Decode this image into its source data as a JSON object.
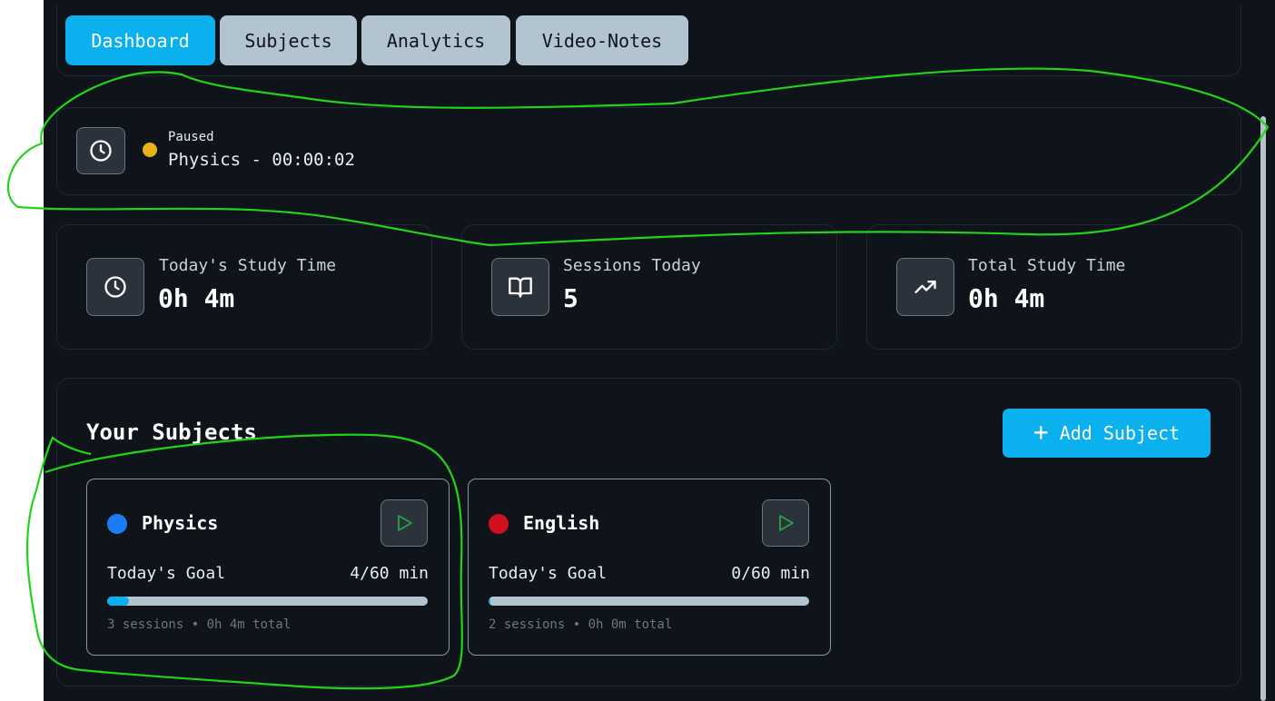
{
  "tabs": [
    {
      "label": "Dashboard",
      "active": true
    },
    {
      "label": "Subjects",
      "active": false
    },
    {
      "label": "Analytics",
      "active": false
    },
    {
      "label": "Video-Notes",
      "active": false
    }
  ],
  "timer": {
    "status": "Paused",
    "text": "Physics - 00:00:02",
    "status_color": "#e8b318"
  },
  "stats": [
    {
      "label": "Today's Study Time",
      "value": "0h 4m",
      "icon": "clock-icon"
    },
    {
      "label": "Sessions Today",
      "value": "5",
      "icon": "book-open-icon"
    },
    {
      "label": "Total Study Time",
      "value": "0h 4m",
      "icon": "trending-up-icon"
    }
  ],
  "subjects_section": {
    "title": "Your Subjects",
    "add_label": "Add Subject"
  },
  "subjects": [
    {
      "name": "Physics",
      "color": "#1a7cf5",
      "goal_label": "Today's Goal",
      "goal_value": "4/60 min",
      "progress": 0.0667,
      "meta": "3 sessions • 0h 4m total"
    },
    {
      "name": "English",
      "color": "#d0101e",
      "goal_label": "Today's Goal",
      "goal_value": "0/60 min",
      "progress": 0.0,
      "meta": "2 sessions • 0h 0m total"
    }
  ],
  "colors": {
    "accent": "#0ab1ee",
    "background": "#0f141b",
    "annotation": "#22d31a"
  }
}
